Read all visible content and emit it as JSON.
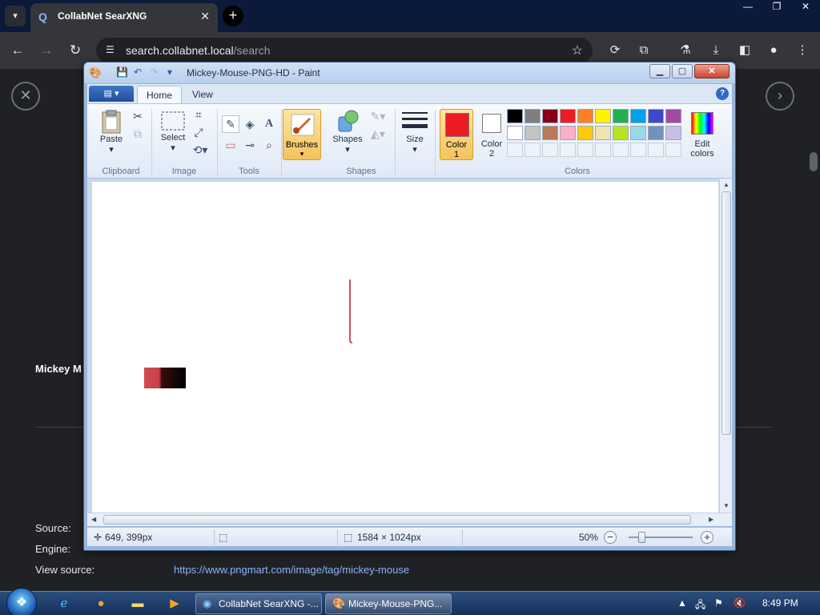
{
  "browser": {
    "tab_title": "CollabNet SearXNG",
    "url_host": "search.collabnet.local",
    "url_path": "/search",
    "window_controls": {
      "minimize": "—",
      "restore": "❐",
      "close": "✕"
    }
  },
  "page": {
    "result_title": "Mickey M",
    "meta": [
      {
        "label": "Source:",
        "value": ""
      },
      {
        "label": "Engine:",
        "value": ""
      },
      {
        "label": "View source:",
        "value": "https://www.pngmart.com/image/tag/mickey-mouse"
      }
    ]
  },
  "paint": {
    "window_title": "Mickey-Mouse-PNG-HD - Paint",
    "tabs": {
      "home": "Home",
      "view": "View"
    },
    "groups": {
      "clipboard": "Clipboard",
      "image": "Image",
      "tools": "Tools",
      "shapes": "Shapes",
      "colors": "Colors"
    },
    "buttons": {
      "paste": "Paste",
      "select": "Select",
      "brushes": "Brushes",
      "shapes": "Shapes",
      "size": "Size",
      "color1_line1": "Color",
      "color1_line2": "1",
      "color2_line1": "Color",
      "color2_line2": "2",
      "edit_colors_line1": "Edit",
      "edit_colors_line2": "colors"
    },
    "color1_value": "#ed1c24",
    "color2_value": "#ffffff",
    "palette_row1": [
      "#000000",
      "#7f7f7f",
      "#880015",
      "#ed1c24",
      "#ff7f27",
      "#fff200",
      "#22b14c",
      "#00a2e8",
      "#3f48cc",
      "#a349a4"
    ],
    "palette_row2": [
      "#ffffff",
      "#c3c3c3",
      "#b97a57",
      "#ffaec9",
      "#ffc90e",
      "#efe4b0",
      "#b5e61d",
      "#99d9ea",
      "#7092be",
      "#c8bfe7"
    ],
    "status": {
      "cursor_pos": "649, 399px",
      "image_size": "1584 × 1024px",
      "zoom": "50%"
    }
  },
  "taskbar": {
    "tasks": [
      {
        "label": "CollabNet SearXNG -...",
        "icon": "chrome-icon"
      },
      {
        "label": "Mickey-Mouse-PNG...",
        "icon": "paint-icon"
      }
    ],
    "clock": "8:49 PM"
  }
}
